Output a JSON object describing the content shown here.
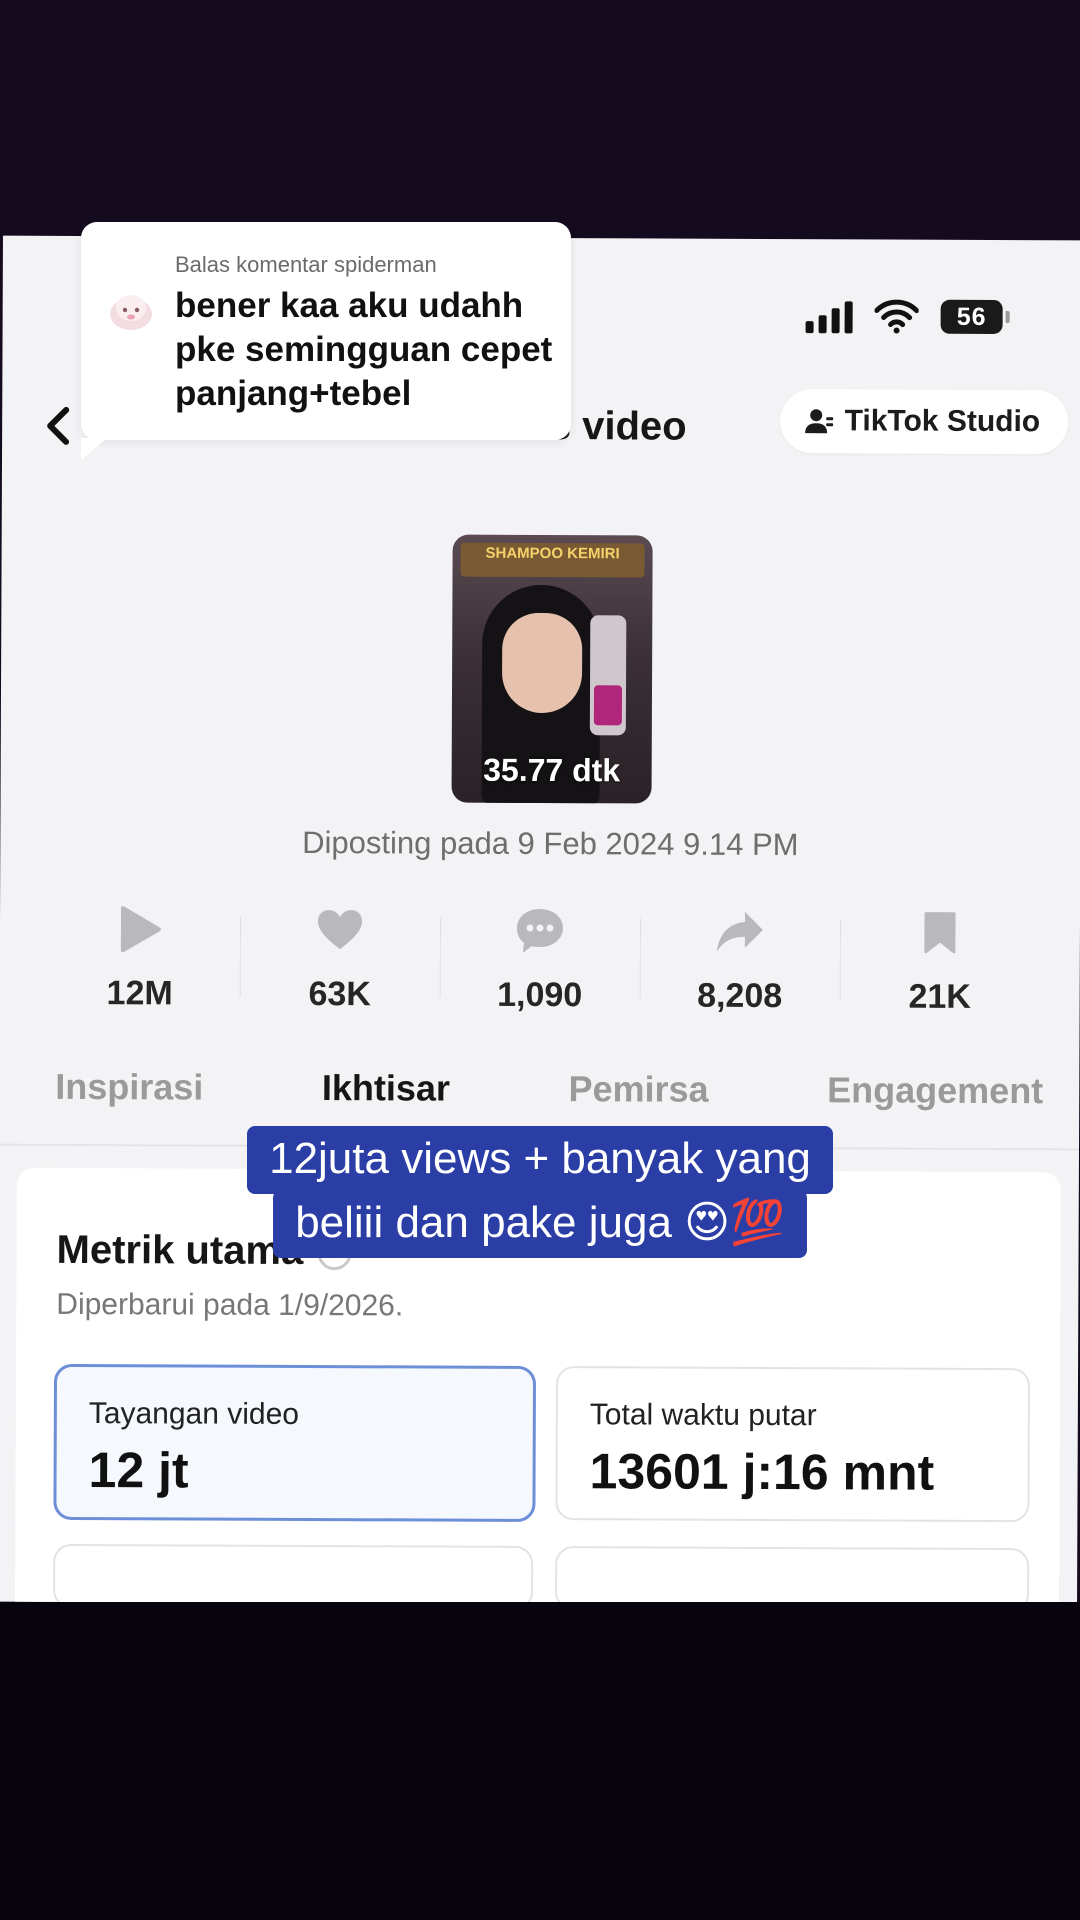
{
  "reply_bubble": {
    "label": "Balas komentar spiderman",
    "text": "bener kaa aku udahh pke semingguan cepet panjang+tebel"
  },
  "status_bar": {
    "battery": "56"
  },
  "header": {
    "title": "Analisis video",
    "studio_button": "TikTok Studio"
  },
  "video": {
    "duration": "35.77 dtk",
    "thumbnail_banner": "SHAMPOO KEMIRI",
    "posted": "Diposting pada 9 Feb 2024 9.14 PM"
  },
  "stats": [
    {
      "icon": "play-icon",
      "value": "12M"
    },
    {
      "icon": "heart-icon",
      "value": "63K"
    },
    {
      "icon": "comment-icon",
      "value": "1,090"
    },
    {
      "icon": "share-icon",
      "value": "8,208"
    },
    {
      "icon": "bookmark-icon",
      "value": "21K"
    }
  ],
  "tabs": [
    {
      "label": "Inspirasi",
      "active": false
    },
    {
      "label": "Ikhtisar",
      "active": true
    },
    {
      "label": "Pemirsa",
      "active": false
    },
    {
      "label": "Engagement",
      "active": false
    }
  ],
  "metrics": {
    "title": "Metrik utama",
    "updated": "Diperbarui pada 1/9/2026.",
    "tiles": [
      {
        "label": "Tayangan video",
        "value": "12 jt"
      },
      {
        "label": "Total waktu putar",
        "value": "13601 j:16 mnt"
      }
    ]
  },
  "caption": {
    "line1": "12juta views + banyak yang",
    "line2": "beliii dan pake juga 😍💯"
  },
  "colors": {
    "caption_bg": "#2b3ea6",
    "selected_tile_border": "#6c8fd8",
    "screen_bg": "#f3f3f5"
  }
}
